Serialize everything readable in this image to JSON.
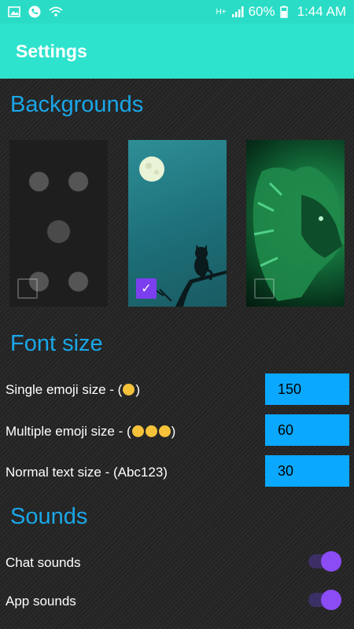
{
  "status": {
    "battery": "60%",
    "time": "1:44 AM",
    "network": "H+",
    "icons": [
      "image-icon",
      "phone-icon",
      "wifi-icon",
      "signal-icon",
      "battery-icon"
    ]
  },
  "appbar": {
    "title": "Settings"
  },
  "backgrounds": {
    "title": "Backgrounds",
    "items": [
      {
        "name": "dark-damask",
        "selected": false
      },
      {
        "name": "moon-cat",
        "selected": true
      },
      {
        "name": "green-lion",
        "selected": false
      }
    ]
  },
  "font_size": {
    "title": "Font size",
    "rows": [
      {
        "label": "Single emoji size - (",
        "emoji_count": 1,
        "suffix": ")",
        "value": "150"
      },
      {
        "label": "Multiple emoji size - (",
        "emoji_count": 3,
        "suffix": ")",
        "value": "60"
      },
      {
        "label": "Normal text size - (Abc123)",
        "emoji_count": 0,
        "suffix": "",
        "value": "30"
      }
    ]
  },
  "sounds": {
    "title": "Sounds",
    "items": [
      {
        "label": "Chat sounds",
        "on": true
      },
      {
        "label": "App sounds",
        "on": true
      }
    ]
  },
  "colors": {
    "accent": "#1aa7e8",
    "appbar": "#2ee3cd",
    "toggle": "#8b4bf5",
    "input": "#0aa8ff"
  }
}
